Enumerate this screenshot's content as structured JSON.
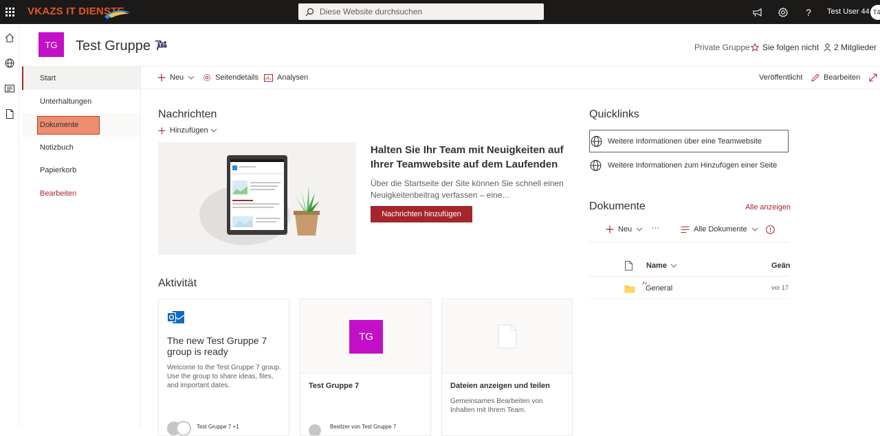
{
  "suite": {
    "brand": "VKAZS IT DIENSTE",
    "search_placeholder": "Diese Website durchsuchen",
    "user_name": "Test User 44",
    "user_initials": "T4",
    "icons": [
      "waffle-icon",
      "megaphone-icon",
      "gear-icon",
      "help-icon"
    ]
  },
  "site": {
    "logo_initials": "TG",
    "title": "Test Gruppe 7",
    "privacy": "Private Gruppe",
    "follow_label": "Sie folgen nicht",
    "members_label": "2 Mitglieder"
  },
  "nav": {
    "items": [
      {
        "label": "Start"
      },
      {
        "label": "Unterhaltungen"
      },
      {
        "label": "Dokumente"
      },
      {
        "label": "Notizbuch"
      },
      {
        "label": "Papierkorb"
      },
      {
        "label": "Bearbeiten"
      }
    ]
  },
  "commandbar": {
    "new_label": "Neu",
    "page_details_label": "Seitendetails",
    "analytics_label": "Analysen",
    "status": "Veröffentlicht",
    "edit_label": "Bearbeiten"
  },
  "news": {
    "title": "Nachrichten",
    "add_label": "Hinzufügen",
    "headline": "Halten Sie Ihr Team mit Neuigkeiten auf Ihrer Teamwebsite auf dem Laufenden",
    "body": "Über die Startseite der Site können Sie schnell einen Neuigkeitenbeitrag verfassen – eine...",
    "button": "Nachrichten hinzufügen"
  },
  "activity": {
    "title": "Aktivität",
    "cards": [
      {
        "title": "The new Test Gruppe 7 group is ready",
        "text": "Welcome to the Test Gruppe 7 group. Use the group to share ideas, files, and important dates.",
        "footer": "Test Gruppe 7 +1"
      },
      {
        "thumb_initials": "TG",
        "title": "Test Gruppe 7",
        "footer": "Besitzer von Test Gruppe 7"
      },
      {
        "title": "Dateien anzeigen und teilen",
        "text": "Gemeinsames Bearbeiten von Inhalten mit Ihrem Team."
      }
    ]
  },
  "quicklinks": {
    "title": "Quicklinks",
    "items": [
      {
        "label": "Weitere Informationen über eine Teamwebsite"
      },
      {
        "label": "Weitere Informationen zum Hinzufügen einer Seite"
      }
    ]
  },
  "documents": {
    "title": "Dokumente",
    "see_all": "Alle anzeigen",
    "new_label": "Neu",
    "more_label": "···",
    "view_label": "Alle Dokumente",
    "columns": {
      "name": "Name",
      "modified": "Geän"
    },
    "rows": [
      {
        "name": "General",
        "modified": "vor 17"
      }
    ]
  },
  "colors": {
    "accent": "#a4262c",
    "site_logo": "#c40fc9",
    "suite_bar": "#1b1a19",
    "brand": "#e8542a",
    "nav_highlight": "#ee8d70"
  }
}
